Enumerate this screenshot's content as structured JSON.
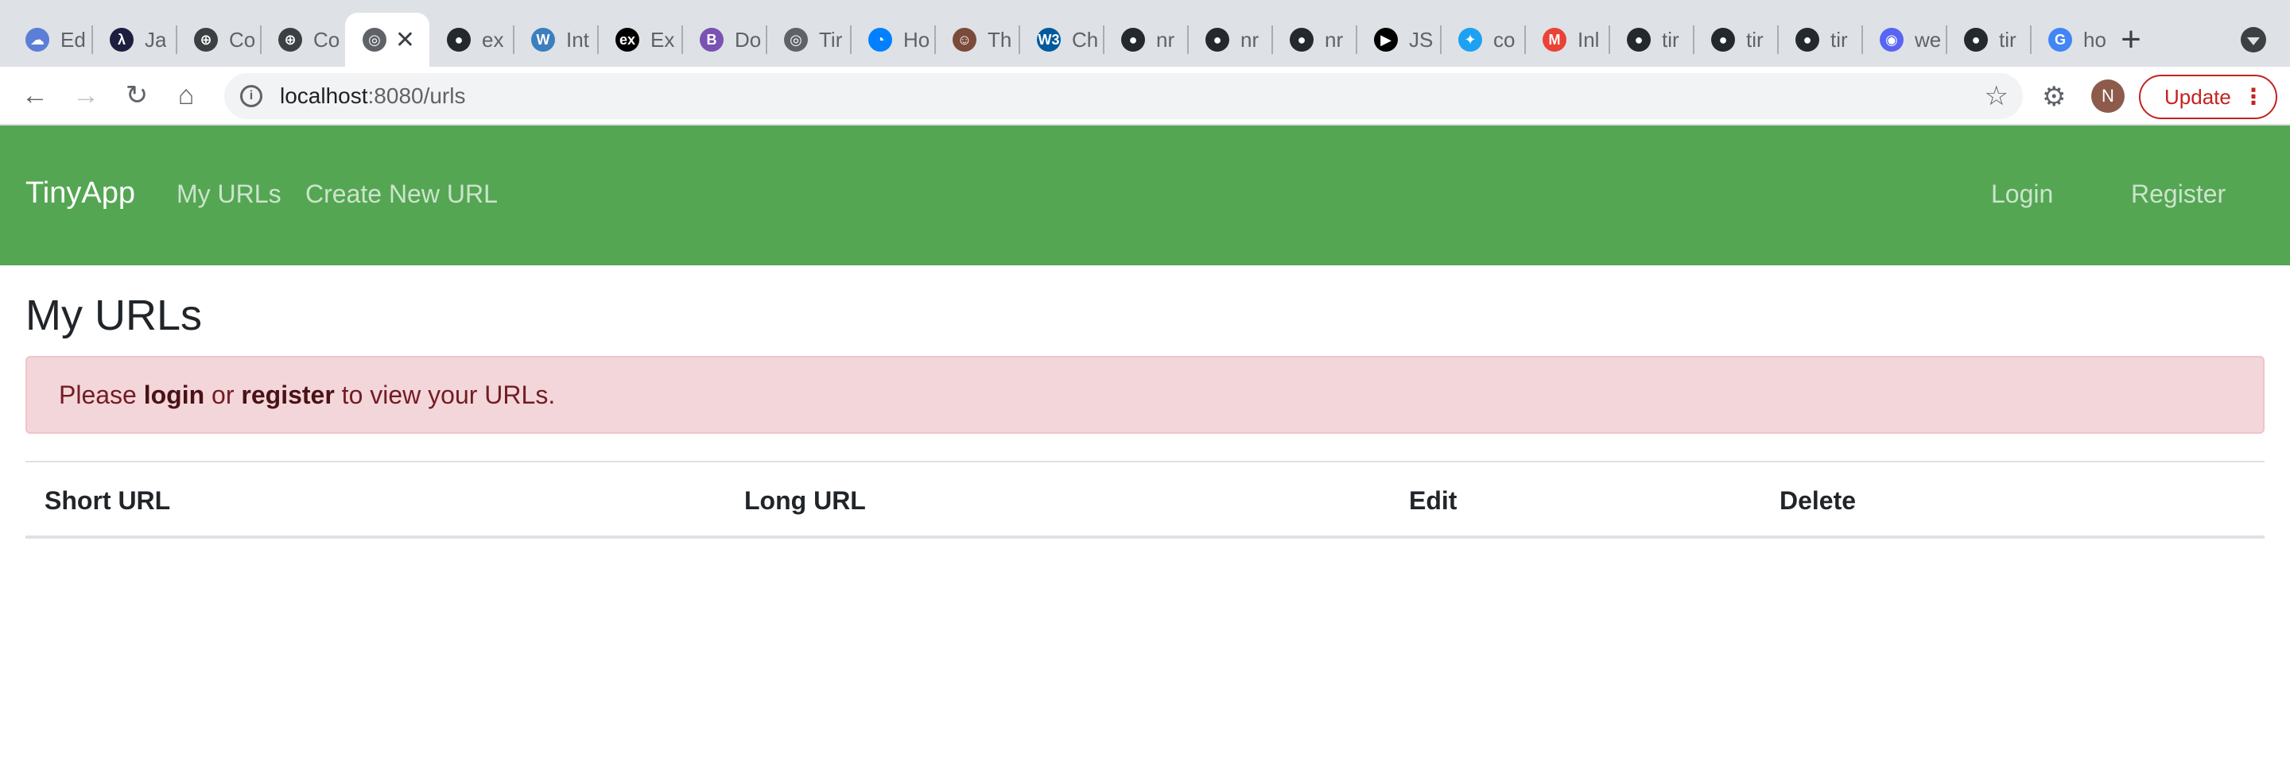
{
  "browser": {
    "tabs": [
      {
        "title": "Ed",
        "icon": "cloud-icon",
        "color": "#5b7fd6"
      },
      {
        "title": "Ja",
        "icon": "lambda-icon",
        "color": "#1e1e3f"
      },
      {
        "title": "Co",
        "icon": "compass-icon",
        "color": "#3c4043"
      },
      {
        "title": "Co",
        "icon": "compass-icon",
        "color": "#3c4043"
      },
      {
        "title": "",
        "icon": "globe-icon",
        "color": "#5f6368",
        "active": true
      },
      {
        "title": "ex",
        "icon": "github-icon",
        "color": "#24292e"
      },
      {
        "title": "Int",
        "icon": "wordpress-icon",
        "color": "#3b7fbf"
      },
      {
        "title": "Ex",
        "icon": "ex-icon",
        "color": "#000000"
      },
      {
        "title": "Do",
        "icon": "bootstrap-icon",
        "color": "#7952b3"
      },
      {
        "title": "Tir",
        "icon": "globe-icon",
        "color": "#5f6368"
      },
      {
        "title": "Ho",
        "icon": "digitalocean-icon",
        "color": "#0080ff"
      },
      {
        "title": "Th",
        "icon": "avatar-icon",
        "color": "#7a4b3a"
      },
      {
        "title": "Ch",
        "icon": "w3c-icon",
        "color": "#005a9c"
      },
      {
        "title": "nr",
        "icon": "github-icon",
        "color": "#24292e"
      },
      {
        "title": "nr",
        "icon": "github-icon",
        "color": "#24292e"
      },
      {
        "title": "nr",
        "icon": "github-icon",
        "color": "#24292e"
      },
      {
        "title": "JS",
        "icon": "pen-icon",
        "color": "#000000"
      },
      {
        "title": "co",
        "icon": "twitter-icon",
        "color": "#1da1f2"
      },
      {
        "title": "Inl",
        "icon": "gmail-icon",
        "color": "#ea4335"
      },
      {
        "title": "tir",
        "icon": "github-icon",
        "color": "#24292e"
      },
      {
        "title": "tir",
        "icon": "github-icon",
        "color": "#24292e"
      },
      {
        "title": "tir",
        "icon": "github-icon",
        "color": "#24292e"
      },
      {
        "title": "we",
        "icon": "discord-icon",
        "color": "#5865f2"
      },
      {
        "title": "tir",
        "icon": "github-icon",
        "color": "#24292e"
      },
      {
        "title": "ho",
        "icon": "google-icon",
        "color": "#4285f4"
      }
    ],
    "address": {
      "host": "localhost",
      "path": ":8080/urls"
    },
    "profile_initial": "N",
    "update_label": "Update"
  },
  "navbar": {
    "brand": "TinyApp",
    "links": [
      "My URLs",
      "Create New URL"
    ],
    "login": "Login",
    "register": "Register"
  },
  "main": {
    "title": "My URLs",
    "alert": {
      "prefix": "Please ",
      "login": "login",
      "middle": " or ",
      "register": "register",
      "suffix": " to view your URLs."
    },
    "table_headers": [
      "Short URL",
      "Long URL",
      "Edit",
      "Delete"
    ]
  },
  "colors": {
    "navbar": "#54a653",
    "alert_bg": "#f3d6d9",
    "alert_text": "#721c24"
  }
}
